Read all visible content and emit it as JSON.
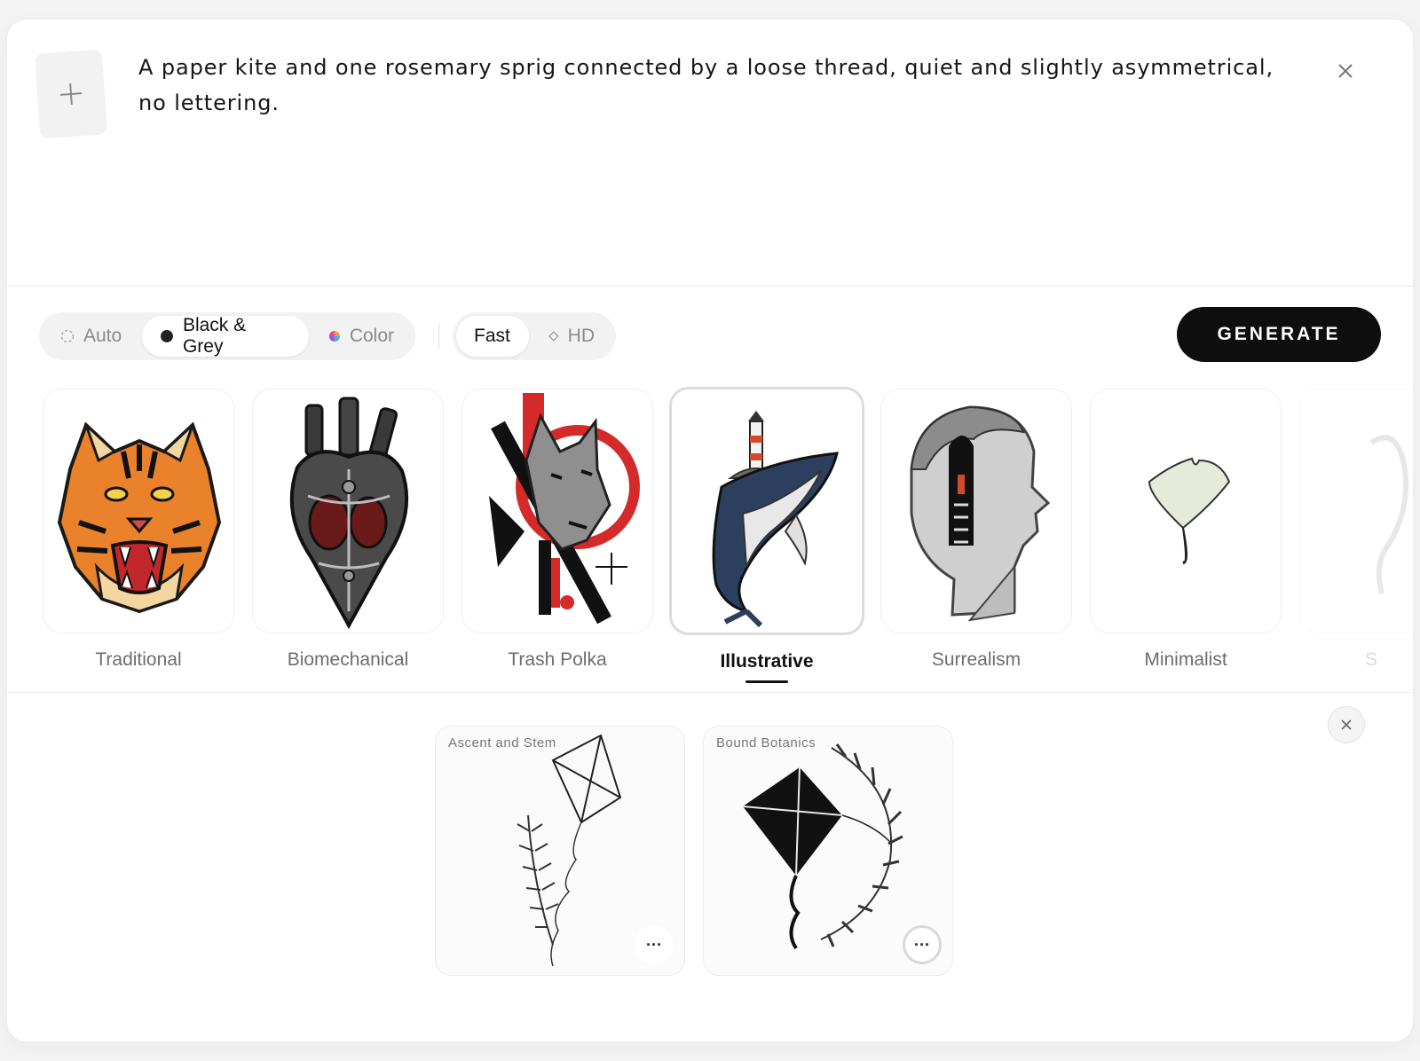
{
  "prompt": {
    "text": "A paper kite and one rosemary sprig connected by a loose thread, quiet and slightly asymmetrical, no lettering.",
    "upload_icon": "plus-icon",
    "close_icon": "close-icon"
  },
  "toolbar": {
    "color_modes": [
      {
        "label": "Auto",
        "icon": "dashed-circle-icon",
        "active": false
      },
      {
        "label": "Black & Grey",
        "icon": "black-dot-icon",
        "active": true
      },
      {
        "label": "Color",
        "icon": "color-dot-icon",
        "active": false
      }
    ],
    "quality": [
      {
        "label": "Fast",
        "active": true
      },
      {
        "label": "HD",
        "icon": "diamond-icon",
        "active": false
      }
    ],
    "generate_label": "GENERATE"
  },
  "styles": [
    {
      "label": "Traditional",
      "image": "tiger-head-illustration",
      "selected": false
    },
    {
      "label": "Biomechanical",
      "image": "mechanical-heart-illustration",
      "selected": false
    },
    {
      "label": "Trash Polka",
      "image": "wolf-red-circle-illustration",
      "selected": true
    },
    {
      "label": "Illustrative",
      "image": "whale-lighthouse-illustration",
      "selected": true
    },
    {
      "label": "Surrealism",
      "image": "statue-head-doorway-illustration",
      "selected": false
    },
    {
      "label": "Minimalist",
      "image": "ginkgo-leaf-illustration",
      "selected": false
    },
    {
      "label": "S",
      "image": "partial-style-thumbnail",
      "selected": false
    }
  ],
  "results": [
    {
      "title": "Ascent and Stem",
      "image": "kite-rosemary-line-art",
      "more_label": "···"
    },
    {
      "title": "Bound Botanics",
      "image": "black-kite-wreath-art",
      "more_label": "···"
    }
  ],
  "colors": {
    "generate_bg": "#0e0e0e",
    "accent_red": "#d42a2a",
    "segment_bg": "#f2f2f2"
  }
}
